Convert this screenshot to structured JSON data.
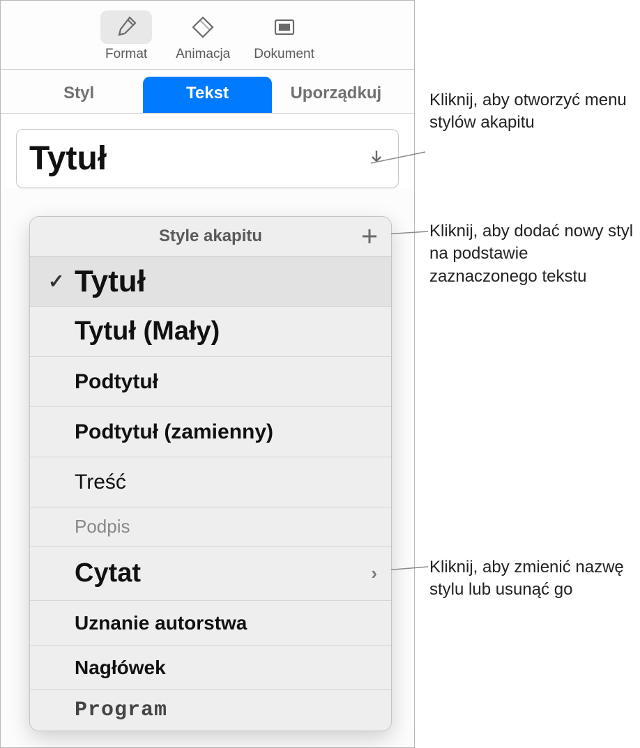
{
  "toolbar": {
    "format": "Format",
    "animation": "Animacja",
    "document": "Dokument"
  },
  "tabs": {
    "style": "Styl",
    "text": "Tekst",
    "arrange": "Uporządkuj"
  },
  "dropdown": {
    "current": "Tytuł"
  },
  "popover": {
    "title": "Style akapitu",
    "items": [
      {
        "label": "Tytuł",
        "selected": true
      },
      {
        "label": "Tytuł (Mały)"
      },
      {
        "label": "Podtytuł"
      },
      {
        "label": "Podtytuł (zamienny)"
      },
      {
        "label": "Treść"
      },
      {
        "label": "Podpis"
      },
      {
        "label": "Cytat",
        "arrow": true
      },
      {
        "label": "Uznanie autorstwa"
      },
      {
        "label": "Nagłówek"
      },
      {
        "label": "Program"
      }
    ]
  },
  "callouts": {
    "c1": "Kliknij, aby otworzyć menu stylów akapitu",
    "c2": "Kliknij, aby dodać nowy styl na podstawie zaznaczonego tekstu",
    "c3": "Kliknij, aby zmienić nazwę stylu lub usunąć go"
  }
}
